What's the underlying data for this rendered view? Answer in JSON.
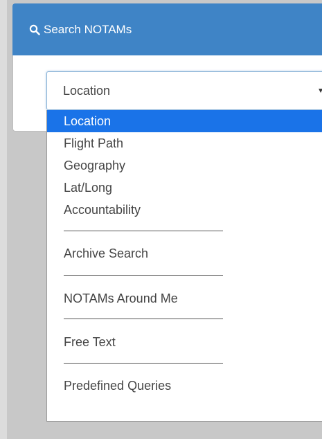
{
  "header": {
    "title": "Search NOTAMs",
    "icon": "search-icon"
  },
  "search_type_select": {
    "value": "Location"
  },
  "dropdown_options": [
    "Location",
    "Flight Path",
    "Geography",
    "Lat/Long",
    "Accountability",
    "Archive Search",
    "NOTAMs Around Me",
    "Free Text",
    "Predefined Queries"
  ],
  "selected_option": "Location",
  "colors": {
    "header_bg": "#3f84c6",
    "highlight": "#1a73e8"
  }
}
